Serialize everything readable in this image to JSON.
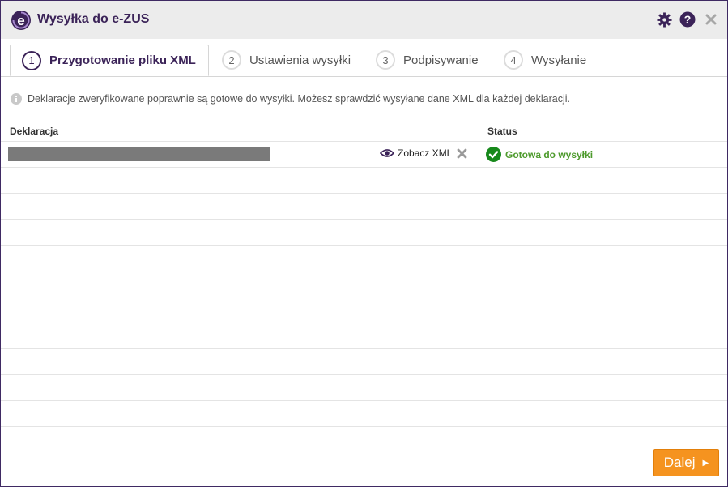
{
  "window": {
    "title": "Wysyłka do e-ZUS",
    "icons": [
      "gear-icon",
      "help-icon",
      "close-icon"
    ]
  },
  "tabs": [
    {
      "num": "1",
      "label": "Przygotowanie pliku XML",
      "active": true
    },
    {
      "num": "2",
      "label": "Ustawienia wysyłki",
      "active": false
    },
    {
      "num": "3",
      "label": "Podpisywanie",
      "active": false
    },
    {
      "num": "4",
      "label": "Wysyłanie",
      "active": false
    }
  ],
  "info": "Deklaracje zweryfikowane poprawnie są gotowe do wysyłki. Możesz sprawdzić wysyłane dane XML dla każdej deklaracji.",
  "table": {
    "columns": [
      "Deklaracja",
      "Status"
    ],
    "rows": [
      {
        "view_label": "Zobacz XML",
        "status": "Gotowa do wysyłki"
      }
    ]
  },
  "footer": {
    "next_label": "Dalej"
  },
  "colors": {
    "accent": "#3b2358",
    "button": "#f5931f",
    "ok": "#4d9a2c"
  }
}
